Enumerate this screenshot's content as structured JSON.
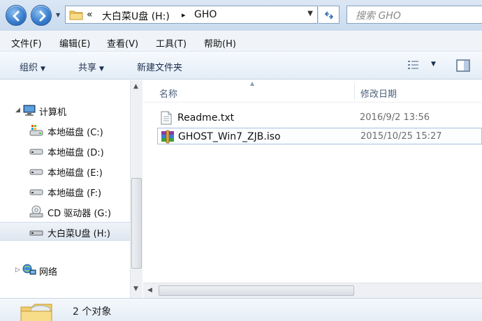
{
  "window": {
    "back_title": "back",
    "forward_title": "forward"
  },
  "address": {
    "chevron": "«",
    "segments": [
      "大白菜U盘 (H:)",
      "GHO"
    ],
    "separator": "▸"
  },
  "search": {
    "placeholder": "搜索 GHO"
  },
  "menu": [
    "文件(F)",
    "编辑(E)",
    "查看(V)",
    "工具(T)",
    "帮助(H)"
  ],
  "toolbar": {
    "organize": "组织",
    "share": "共享",
    "new_folder": "新建文件夹"
  },
  "nav_tree": [
    {
      "label": "计算机",
      "icon": "computer-icon"
    },
    {
      "label": "本地磁盘 (C:)",
      "icon": "system-drive-icon"
    },
    {
      "label": "本地磁盘 (D:)",
      "icon": "hard-drive-icon"
    },
    {
      "label": "本地磁盘 (E:)",
      "icon": "hard-drive-icon"
    },
    {
      "label": "本地磁盘 (F:)",
      "icon": "hard-drive-icon"
    },
    {
      "label": "CD 驱动器 (G:)",
      "icon": "cd-drive-icon"
    },
    {
      "label": "大白菜U盘 (H:)",
      "icon": "usb-drive-icon",
      "selected": true
    },
    {
      "label": "网络",
      "icon": "network-icon"
    }
  ],
  "columns": {
    "name": "名称",
    "modified": "修改日期"
  },
  "files": [
    {
      "name": "Readme.txt",
      "modified": "2016/9/2 13:56",
      "icon": "text-file-icon"
    },
    {
      "name": "GHOST_Win7_ZJB.iso",
      "modified": "2015/10/25 15:27",
      "icon": "archive-file-icon",
      "selected": true
    }
  ],
  "status": {
    "item_count": "2 个对象"
  },
  "colors": {
    "accent": "#3a7fcf",
    "selection_border": "#a6c1e2",
    "header_text": "#4c607a"
  }
}
